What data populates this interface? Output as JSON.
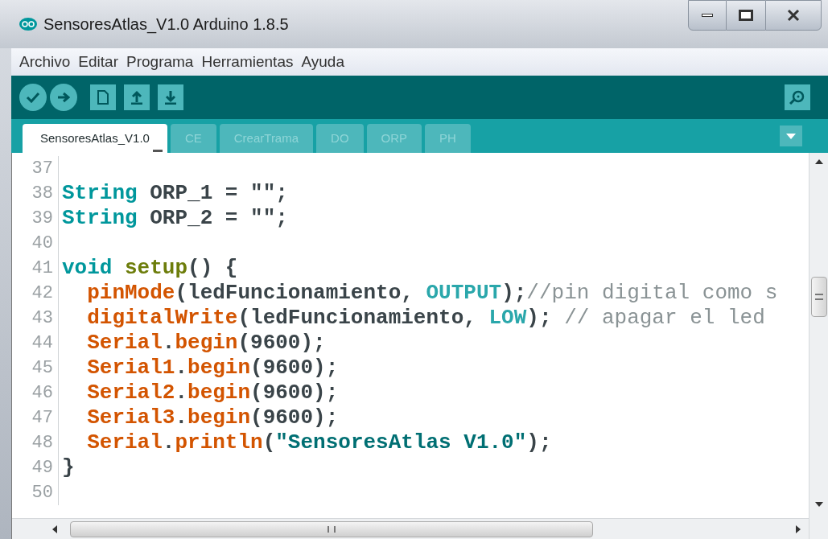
{
  "window": {
    "title": "SensoresAtlas_V1.0 Arduino 1.8.5"
  },
  "menu": [
    "Archivo",
    "Editar",
    "Programa",
    "Herramientas",
    "Ayuda"
  ],
  "tabs": [
    {
      "label": "SensoresAtlas_V1.0",
      "selected": true
    },
    {
      "label": "CE",
      "selected": false
    },
    {
      "label": "CrearTrama",
      "selected": false
    },
    {
      "label": "DO",
      "selected": false
    },
    {
      "label": "ORP",
      "selected": false
    },
    {
      "label": "PH",
      "selected": false
    }
  ],
  "editor": {
    "lines": [
      {
        "number": "37"
      },
      {
        "number": "38",
        "tokens": [
          {
            "text": "String",
            "kind": "type"
          },
          {
            "text": " ORP_1 = \"\";",
            "kind": "plain"
          }
        ]
      },
      {
        "number": "39",
        "tokens": [
          {
            "text": "String",
            "kind": "type"
          },
          {
            "text": " ORP_2 = \"\";",
            "kind": "plain"
          }
        ]
      },
      {
        "number": "40"
      },
      {
        "number": "41",
        "tokens": [
          {
            "text": "void ",
            "kind": "type"
          },
          {
            "text": "setup",
            "kind": "name"
          },
          {
            "text": "() {",
            "kind": "plain"
          }
        ]
      },
      {
        "number": "42",
        "tokens": [
          {
            "text": "  pinMode",
            "kind": "call"
          },
          {
            "text": "(ledFuncionamiento, ",
            "kind": "plain"
          },
          {
            "text": "OUTPUT",
            "kind": "constant"
          },
          {
            "text": ");",
            "kind": "plain"
          },
          {
            "text": "//pin digital como s",
            "kind": "comment"
          }
        ]
      },
      {
        "number": "43",
        "tokens": [
          {
            "text": "  digitalWrite",
            "kind": "call"
          },
          {
            "text": "(ledFuncionamiento, ",
            "kind": "plain"
          },
          {
            "text": "LOW",
            "kind": "constant"
          },
          {
            "text": "); ",
            "kind": "plain"
          },
          {
            "text": "// apagar el led",
            "kind": "comment"
          }
        ]
      },
      {
        "number": "44",
        "tokens": [
          {
            "text": "  Serial",
            "kind": "call"
          },
          {
            "text": ".",
            "kind": "plain"
          },
          {
            "text": "begin",
            "kind": "call"
          },
          {
            "text": "(9600);",
            "kind": "plain"
          }
        ]
      },
      {
        "number": "45",
        "tokens": [
          {
            "text": "  Serial1",
            "kind": "call"
          },
          {
            "text": ".",
            "kind": "plain"
          },
          {
            "text": "begin",
            "kind": "call"
          },
          {
            "text": "(9600);",
            "kind": "plain"
          }
        ]
      },
      {
        "number": "46",
        "tokens": [
          {
            "text": "  Serial2",
            "kind": "call"
          },
          {
            "text": ".",
            "kind": "plain"
          },
          {
            "text": "begin",
            "kind": "call"
          },
          {
            "text": "(9600);",
            "kind": "plain"
          }
        ]
      },
      {
        "number": "47",
        "tokens": [
          {
            "text": "  Serial3",
            "kind": "call"
          },
          {
            "text": ".",
            "kind": "plain"
          },
          {
            "text": "begin",
            "kind": "call"
          },
          {
            "text": "(9600);",
            "kind": "plain"
          }
        ]
      },
      {
        "number": "48",
        "tokens": [
          {
            "text": "  Serial",
            "kind": "call"
          },
          {
            "text": ".",
            "kind": "plain"
          },
          {
            "text": "println",
            "kind": "call"
          },
          {
            "text": "(",
            "kind": "plain"
          },
          {
            "text": "\"SensoresAtlas V1.0\"",
            "kind": "string"
          },
          {
            "text": ");",
            "kind": "plain"
          }
        ]
      },
      {
        "number": "49",
        "tokens": [
          {
            "text": "}",
            "kind": "plain"
          }
        ]
      },
      {
        "number": "50"
      }
    ]
  }
}
